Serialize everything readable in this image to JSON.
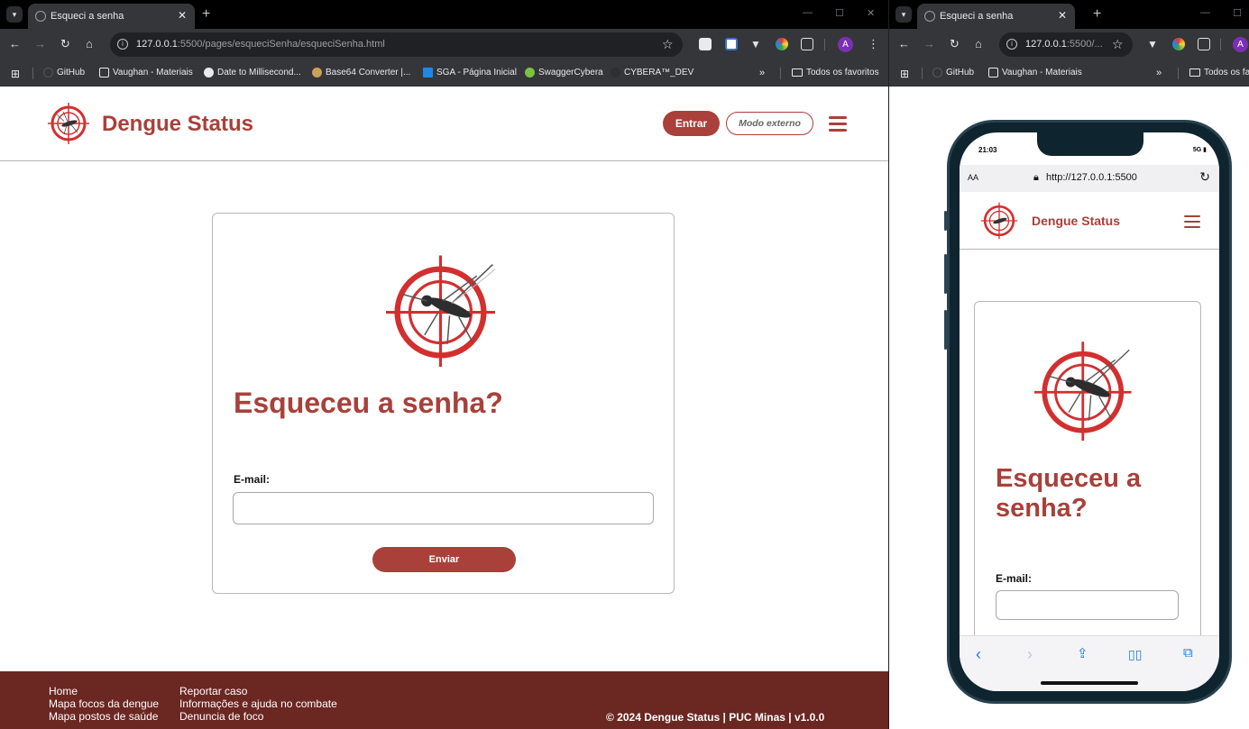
{
  "browser_left": {
    "tab_title": "Esqueci a senha",
    "url_host": "127.0.0.1",
    "url_path": ":5500/pages/esqueciSenha/esqueciSenha.html",
    "bookmarks": [
      "GitHub",
      "Vaughan - Materiais",
      "Date to Millisecond...",
      "Base64 Converter |...",
      "SGA - Página Inicial",
      "SwaggerCybera",
      "CYBERA™_DEV"
    ],
    "more": "»",
    "all_bookmarks": "Todos os favoritos",
    "avatar_letter": "A"
  },
  "browser_right": {
    "tab_title": "Esqueci a senha",
    "url_host": "127.0.0.1",
    "url_path": ":5500/...",
    "bookmarks": [
      "GitHub",
      "Vaughan - Materiais"
    ],
    "more": "»",
    "all_bookmarks": "Todos os fa",
    "avatar_letter": "A"
  },
  "site": {
    "brand": "Dengue Status",
    "login_button": "Entrar",
    "external_mode_button": "Modo externo",
    "heading": "Esqueceu a senha?",
    "heading_line1": "Esqueceu a",
    "heading_line2": "senha?",
    "email_label": "E-mail:",
    "email_value": "",
    "submit_button": "Enviar",
    "footer": {
      "col1": [
        "Home",
        "Mapa focos da dengue",
        "Mapa postos de saúde"
      ],
      "col2": [
        "Reportar caso",
        "Informações e ajuda no combate",
        "Denuncia de foco"
      ],
      "copyright": "© 2024 Dengue Status | PUC Minas | v1.0.0"
    }
  },
  "phone": {
    "time": "21:03",
    "signal": "5G",
    "text_size": "AA",
    "address": "http://127.0.0.1:5500"
  },
  "colors": {
    "brand": "#a9403a",
    "footer": "#6b2722"
  }
}
